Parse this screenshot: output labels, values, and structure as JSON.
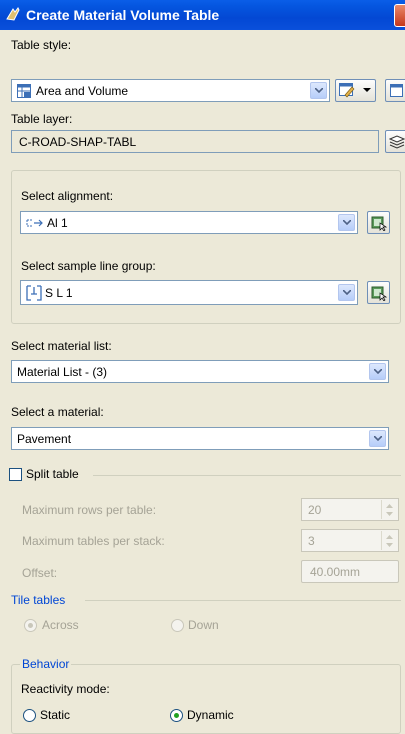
{
  "window": {
    "title": "Create Material Volume Table",
    "icon": "civil3d-app-icon",
    "close_icon": "close-icon"
  },
  "table_style": {
    "label": "Table style:",
    "value": "Area and Volume",
    "icon": "table-style-icon"
  },
  "table_layer": {
    "label": "Table layer:",
    "value": "C-ROAD-SHAP-TABL",
    "icon": "layer-icon"
  },
  "alignment": {
    "label": "Select alignment:",
    "value": "Al 1",
    "icon": "alignment-icon",
    "pick_icon": "pick-from-drawing-icon"
  },
  "sample_line_group": {
    "label": "Select sample line group:",
    "value": "S L 1",
    "icon": "sample-line-group-icon",
    "pick_icon": "pick-from-drawing-icon"
  },
  "material_list": {
    "label": "Select material list:",
    "value": "Material List - (3)"
  },
  "material": {
    "label": "Select a material:",
    "value": "Pavement"
  },
  "split_table": {
    "label": "Split table",
    "checked": false,
    "max_rows_label": "Maximum rows per table:",
    "max_rows_value": "20",
    "max_tables_label": "Maximum tables per stack:",
    "max_tables_value": "3",
    "offset_label": "Offset:",
    "offset_value": "40.00mm"
  },
  "tile_tables": {
    "label": "Tile tables",
    "across_label": "Across",
    "down_label": "Down",
    "selected": "Across"
  },
  "behavior": {
    "label": "Behavior",
    "reactivity_label": "Reactivity mode:",
    "static_label": "Static",
    "dynamic_label": "Dynamic",
    "selected": "Dynamic"
  }
}
